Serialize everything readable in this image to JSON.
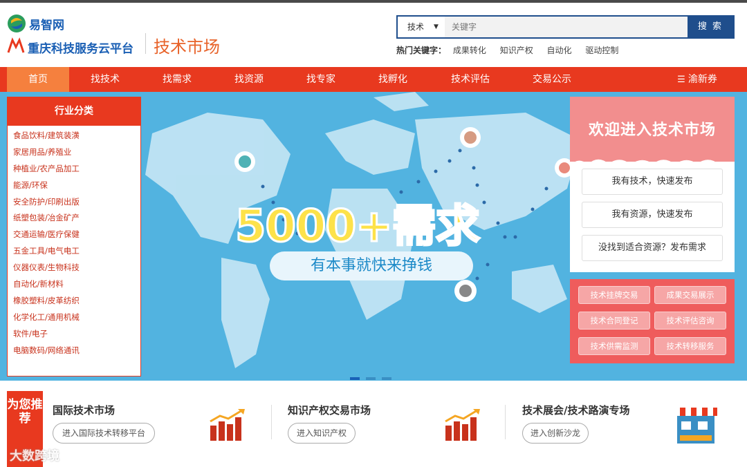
{
  "header": {
    "logo_line1": "易智网",
    "logo_line2": "重庆科技服务云平台",
    "logo_line3": "技术市场"
  },
  "search": {
    "type_label": "技术",
    "caret": "▼",
    "placeholder": "关键字",
    "button_label": "搜 索",
    "hot_label": "热门关键字：",
    "hot_keywords": [
      "成果转化",
      "知识产权",
      "自动化",
      "驱动控制"
    ]
  },
  "nav": {
    "items": [
      "首页",
      "找技术",
      "找需求",
      "找资源",
      "找专家",
      "找孵化",
      "技术评估",
      "交易公示"
    ],
    "coupon_glyph": "☰",
    "coupon_label": "渝新券"
  },
  "categories": {
    "title": "行业分类",
    "items": [
      "食品饮料/建筑装潢",
      "家居用品/养殖业",
      "种植业/农产品加工",
      "能源/环保",
      "安全防护/印刷出版",
      "纸塑包装/冶金矿产",
      "交通运输/医疗保健",
      "五金工具/电气电工",
      "仪器仪表/生物科技",
      "自动化/新材料",
      "橡胶塑料/皮革纺织",
      "化学化工/通用机械",
      "软件/电子",
      "电脑数码/网络通讯"
    ]
  },
  "banner": {
    "headline": "5000+需求",
    "subline": "有本事就快来挣钱"
  },
  "right_panel": {
    "welcome": "欢迎进入技术市场",
    "buttons": [
      "我有技术，快速发布",
      "我有资源，快速发布",
      "没找到适合资源？发布需求"
    ]
  },
  "services": [
    "技术挂牌交易",
    "成果交易展示",
    "技术合同登记",
    "技术评估咨询",
    "技术供需监测",
    "技术转移服务"
  ],
  "recommend": {
    "tag": "为您推荐",
    "blocks": [
      {
        "title": "国际技术市场",
        "button": "进入国际技术转移平台"
      },
      {
        "title": "知识产权交易市场",
        "button": "进入知识产权"
      },
      {
        "title": "技术展会/技术路演专场",
        "button": "进入创新沙龙"
      }
    ]
  },
  "watermark": "大数跨境",
  "colors": {
    "nav_red": "#e8391f",
    "nav_active": "#f5803e",
    "brand_blue": "#1f4e8c",
    "banner_blue": "#52b3e0",
    "service_red": "#ef5c5c"
  }
}
